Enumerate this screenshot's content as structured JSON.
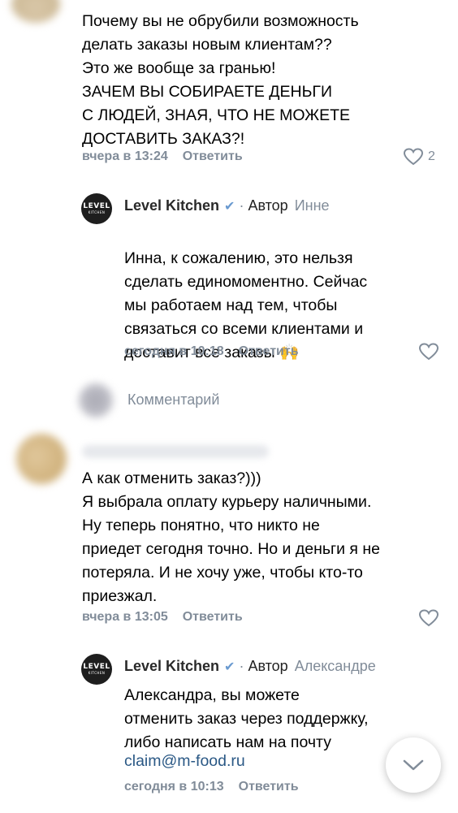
{
  "comment1": {
    "text": "Почему вы не обрубили возможность\nделать заказы новым клиентам??\nЭто же вообще за гранью!\nЗАЧЕМ ВЫ СОБИРАЕТЕ ДЕНЬГИ\nС ЛЮДЕЙ, ЗНАЯ, ЧТО НЕ МОЖЕТЕ\nДОСТАВИТЬ ЗАКАЗ?!",
    "time": "вчера в 13:24",
    "reply": "Ответить",
    "likes": "2"
  },
  "reply1": {
    "name": "Level Kitchen",
    "author_label": "Автор",
    "to": "Инне",
    "text": "Инна, к сожалению, это нельзя\nсделать единомоментно. Сейчас\nмы работаем над тем, чтобы\nсвязаться со всеми клиентами и\nдоставит все заказы",
    "emoji": "🙌",
    "time": "сегодня в 10:18",
    "reply": "Ответить"
  },
  "comment_input": {
    "placeholder": "Комментарий"
  },
  "comment2": {
    "text": "А как отменить заказ?)))\nЯ выбрала оплату курьеру наличными.\nНу теперь понятно, что никто не\nприедет сегодня точно. Но и деньги я не\nпотеряла. И не хочу уже, чтобы кто-то\nприезжал.",
    "time": "вчера в 13:05",
    "reply": "Ответить"
  },
  "reply2": {
    "name": "Level Kitchen",
    "author_label": "Автор",
    "to": "Александре",
    "text": "Александра, вы можете\nотменить заказ через поддержку,\nлибо написать нам на почту",
    "link": "claim@m-food.ru",
    "time": "сегодня в 10:13",
    "reply": "Ответить"
  },
  "logo": {
    "line1": "LEVEL",
    "line2": "KITCHEN"
  },
  "colors": {
    "meta": "#818c99",
    "link": "#2a5885",
    "verified": "#6a9ad0"
  }
}
